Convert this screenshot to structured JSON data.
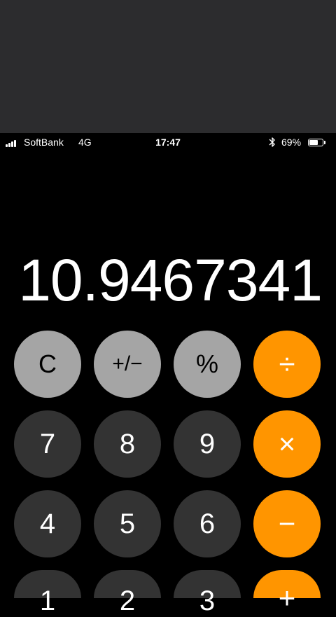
{
  "status_bar": {
    "carrier": "SoftBank",
    "network": "4G",
    "time": "17:47",
    "battery_percent": "69%",
    "battery_level": 0.69,
    "icons": [
      "signal-bars",
      "bluetooth-icon",
      "battery-icon"
    ]
  },
  "display": {
    "value": "10.9467341"
  },
  "keys": {
    "clear": "C",
    "sign": "+/−",
    "percent": "%",
    "divide": "÷",
    "seven": "7",
    "eight": "8",
    "nine": "9",
    "multiply": "×",
    "four": "4",
    "five": "5",
    "six": "6",
    "minus": "−",
    "one": "1",
    "two": "2",
    "three": "3",
    "plus": "+"
  },
  "colors": {
    "function_key": "#a5a5a5",
    "number_key": "#333333",
    "operator_key": "#ff9500",
    "background": "#000000"
  }
}
